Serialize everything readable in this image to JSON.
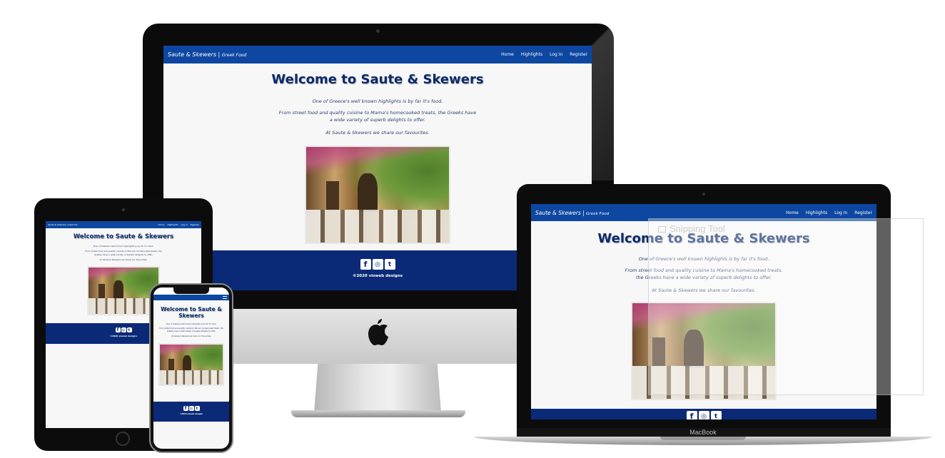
{
  "site": {
    "brand": "Saute & Skewers",
    "brand_sub": "Greek Food",
    "nav_links": [
      "Home",
      "Highlights",
      "Log In",
      "Register"
    ],
    "heading": "Welcome to Saute & Skewers",
    "para1": "One of Greece's well known highlights is by far it's food.",
    "para2": "From street food and quality cuisine to Mama's homecooked treats, the Greeks have a wide variety of superb delights to offer.",
    "para3": "At Saute & Skewers we share our favourites.",
    "social_icons": [
      "facebook-icon",
      "instagram-icon",
      "twitter-icon"
    ],
    "copyright": "©2020 visweb designs"
  },
  "device_labels": {
    "macbook": "MacBook"
  },
  "overlay": {
    "snipping_tool": "Snipping Tool"
  },
  "colors": {
    "nav": "#0d47a1",
    "footer": "#0a2a78",
    "heading": "#0a2a6b"
  }
}
